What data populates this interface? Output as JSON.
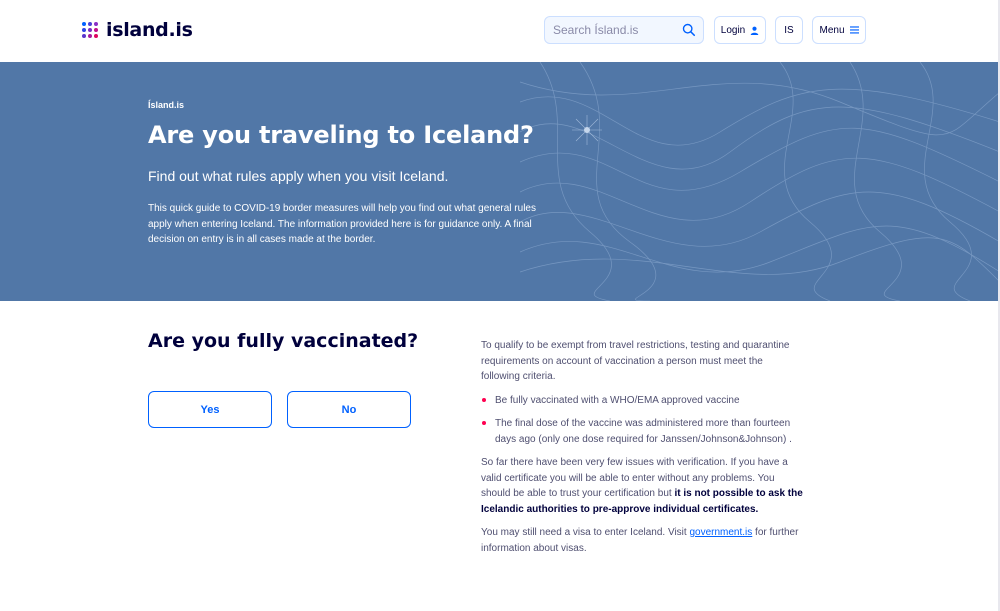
{
  "header": {
    "logo_text": "island.is",
    "search_placeholder": "Search Ísland.is",
    "login_label": "Login",
    "lang_label": "IS",
    "menu_label": "Menu"
  },
  "hero": {
    "breadcrumb": "Ísland.is",
    "title": "Are you traveling to Iceland?",
    "subtitle": "Find out what rules apply when you visit Iceland.",
    "description": "This quick guide to COVID-19 border measures will help you find out what general rules apply when entering Iceland. The information provided here is for guidance only. A final decision on entry is in all cases made at the border."
  },
  "main": {
    "question": "Are you fully vaccinated?",
    "yes_label": "Yes",
    "no_label": "No"
  },
  "info": {
    "intro": "To qualify to be exempt from travel restrictions, testing and quarantine requirements on account of vaccination a person must meet the following criteria.",
    "criteria": [
      "Be fully vaccinated with a WHO/EMA approved vaccine",
      "The final dose of the vaccine was administered more than fourteen days ago (only one dose required for Janssen/Johnson&Johnson) ."
    ],
    "verification_text": "So far there have been very few issues with verification. If you have a valid certificate you will be able to enter without any problems. You should be able to trust your certification but ",
    "verification_bold": "it is not possible to ask the Icelandic authorities to pre-approve individual certificates.",
    "visa_text": "You may still need a visa to enter Iceland. Visit ",
    "visa_link": "government.is",
    "visa_text_end": " for further information about visas."
  },
  "colors": {
    "hero_bg": "#5177a7",
    "primary_blue": "#0061ff",
    "navy": "#00003c",
    "bullet_red": "#ff0050"
  },
  "icons": {
    "logo": "island-dots-logo",
    "search": "search-icon",
    "login": "user-icon",
    "menu": "menu-icon"
  }
}
